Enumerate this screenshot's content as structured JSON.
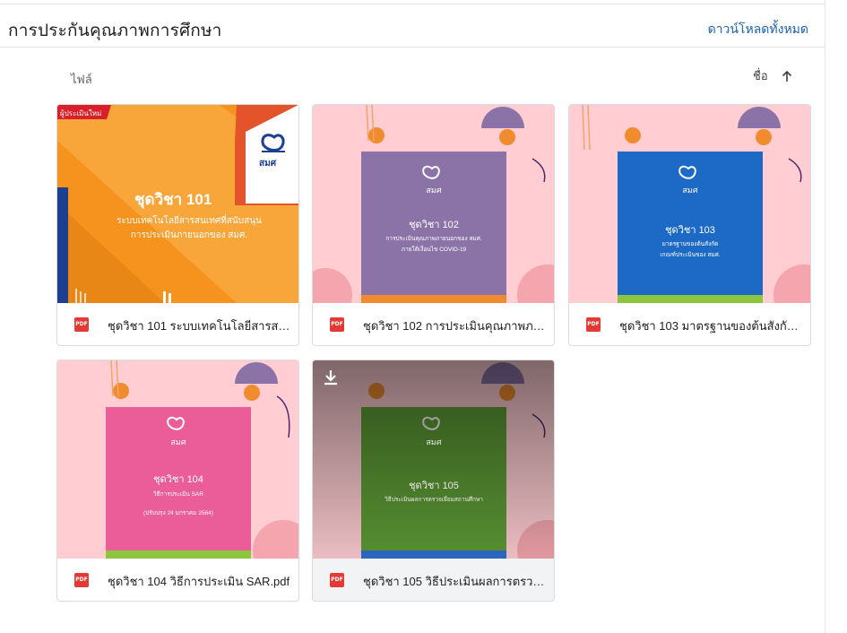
{
  "header": {
    "title": "การประกันคุณภาพการศึกษา",
    "download_all": "ดาวน์โหลดทั้งหมด"
  },
  "toolbar": {
    "files_label": "ไฟล์",
    "sort_label": "ชื่อ"
  },
  "files": [
    {
      "name": "ชุดวิชา 101 ระบบเทคโนโลยีสารสนเทศที่สนับสนุน...",
      "file_type": "PDF",
      "cover": {
        "badge": "ผู้ประเมินใหม่",
        "logo": "สมศ",
        "title": "ชุดวิชา 101",
        "subtitle_1": "ระบบเทคโนโลยีสารสนเทศที่สนับสนุน",
        "subtitle_2": "การประเมินภายนอกของ สมศ.",
        "colors": {
          "bg": "#f6921e",
          "panel": "#1d3f8f",
          "accent": "#e4542a"
        }
      }
    },
    {
      "name": "ชุดวิชา 102 การประเมินคุณภาพภาย...",
      "file_type": "PDF",
      "cover": {
        "logo": "สมศ",
        "title": "ชุดวิชา 102",
        "subtitle_1": "การประเมินคุณภาพภายนอกของ สมศ.",
        "subtitle_2": "ภายใต้เงื่อนไข COVID-19",
        "colors": {
          "bg": "#ffcdd2",
          "panel": "#8b73a8",
          "accent": "#f08c2e"
        }
      }
    },
    {
      "name": "ชุดวิชา 103 มาตรฐานของต้นสังกัด เ...",
      "file_type": "PDF",
      "cover": {
        "logo": "สมศ",
        "title": "ชุดวิชา 103",
        "subtitle_1": "มาตรฐานของต้นสังกัด",
        "subtitle_2": "เกณฑ์ประเมินของ สมศ.",
        "colors": {
          "bg": "#ffcdd2",
          "panel": "#1d6ac6",
          "accent": "#f08c2e"
        }
      }
    },
    {
      "name": "ชุดวิชา 104 วิธีการประเมิน SAR.pdf",
      "file_type": "PDF",
      "cover": {
        "logo": "สมศ",
        "title": "ชุดวิชา 104",
        "subtitle_1": "วิธีการประเมิน SAR",
        "subtitle_2": "(ปรับปรุง 24 มกราคม 2564)",
        "colors": {
          "bg": "#ffcdd2",
          "panel": "#ea5d98",
          "accent": "#8cc63f"
        }
      }
    },
    {
      "name": "ชุดวิชา 105 วิธีประเมินผลการตรวจเ...",
      "file_type": "PDF",
      "cover": {
        "logo": "สมศ",
        "title": "ชุดวิชา 105",
        "subtitle_1": "วิธีประเมินผลการตรวจเยี่ยมสถานศึกษา",
        "colors": {
          "bg": "#ffcdd2",
          "panel": "#5e9c36",
          "accent": "#2f6fd0"
        }
      }
    }
  ]
}
